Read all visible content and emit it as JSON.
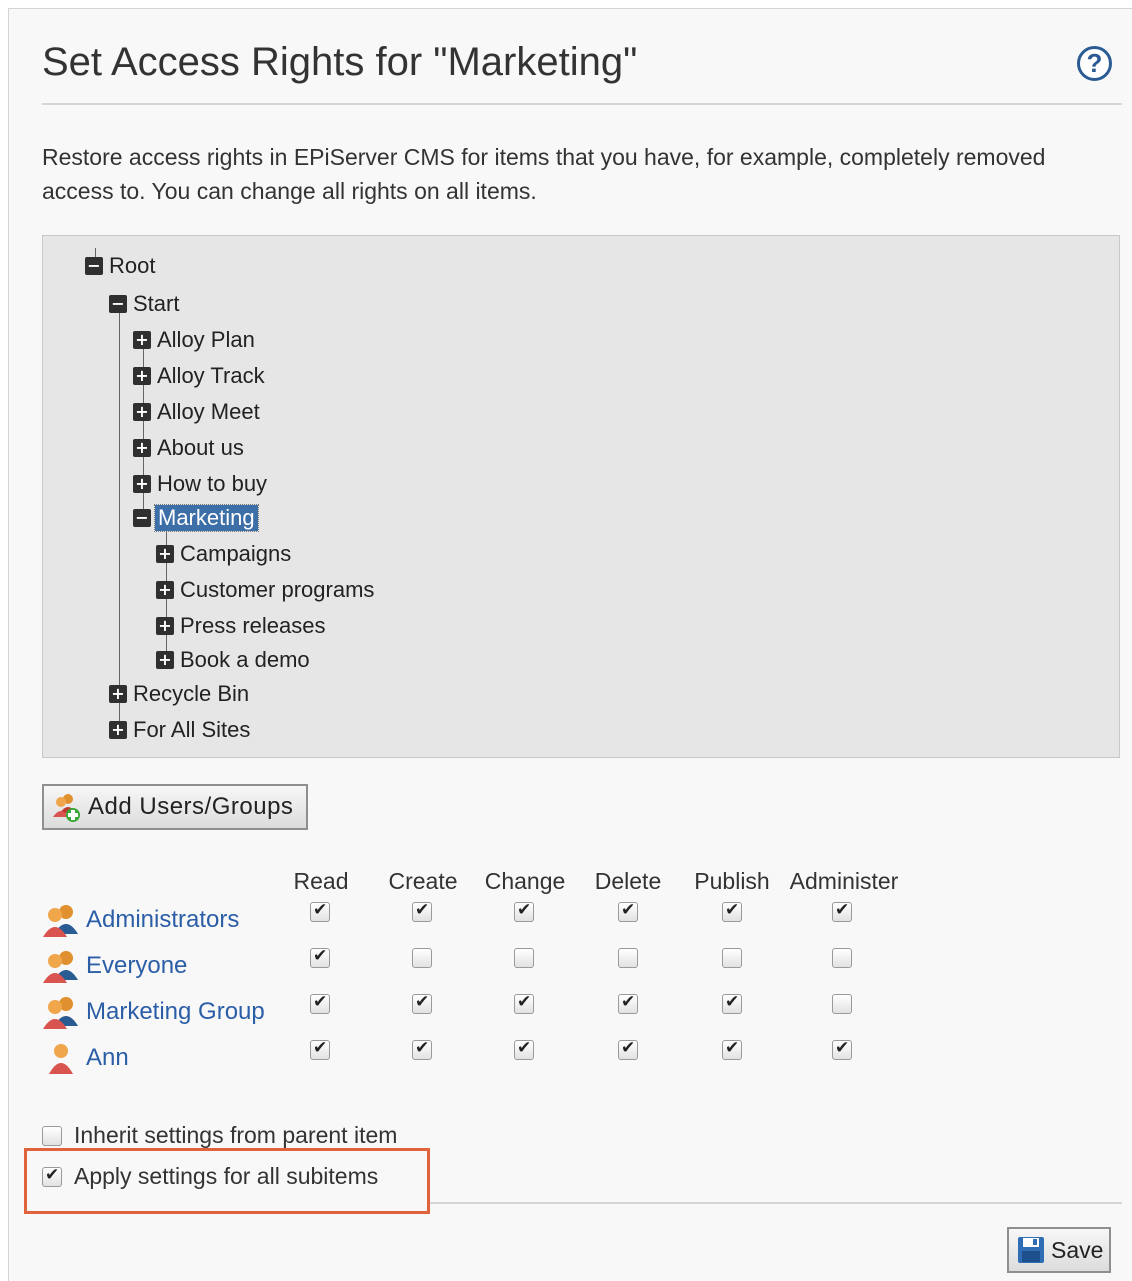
{
  "title": "Set Access Rights for \"Marketing\"",
  "help_icon": "?",
  "description": "Restore access rights in EPiServer CMS for items that you have, for example, completely removed access to. You can change all rights on all items.",
  "tree": {
    "root": "Root",
    "start": "Start",
    "start_children": [
      "Alloy Plan",
      "Alloy Track",
      "Alloy Meet",
      "About us",
      "How to buy"
    ],
    "selected": "Marketing",
    "marketing_children": [
      "Campaigns",
      "Customer programs",
      "Press releases",
      "Book a demo"
    ],
    "root_children": [
      "Recycle Bin",
      "For All Sites"
    ],
    "expand_glyph": "+",
    "collapse_glyph": "−"
  },
  "add_button_label": "Add Users/Groups",
  "permissions": {
    "columns": [
      "Read",
      "Create",
      "Change",
      "Delete",
      "Publish",
      "Administer"
    ],
    "rows": [
      {
        "name": "Administrators",
        "icon": "group-icon",
        "values": [
          true,
          true,
          true,
          true,
          true,
          true
        ]
      },
      {
        "name": "Everyone",
        "icon": "group-icon",
        "values": [
          true,
          false,
          false,
          false,
          false,
          false
        ]
      },
      {
        "name": "Marketing Group",
        "icon": "group-icon",
        "values": [
          true,
          true,
          true,
          true,
          true,
          false
        ]
      },
      {
        "name": "Ann",
        "icon": "user-icon",
        "values": [
          true,
          true,
          true,
          true,
          true,
          true
        ]
      }
    ]
  },
  "options": {
    "inherit_label": "Inherit settings from parent item",
    "inherit_checked": false,
    "apply_label": "Apply settings for all subitems",
    "apply_checked": true
  },
  "save_label": "Save",
  "colors": {
    "link": "#2b5ea7",
    "selection": "#3c6ea8",
    "highlight_border": "#e0633c"
  }
}
